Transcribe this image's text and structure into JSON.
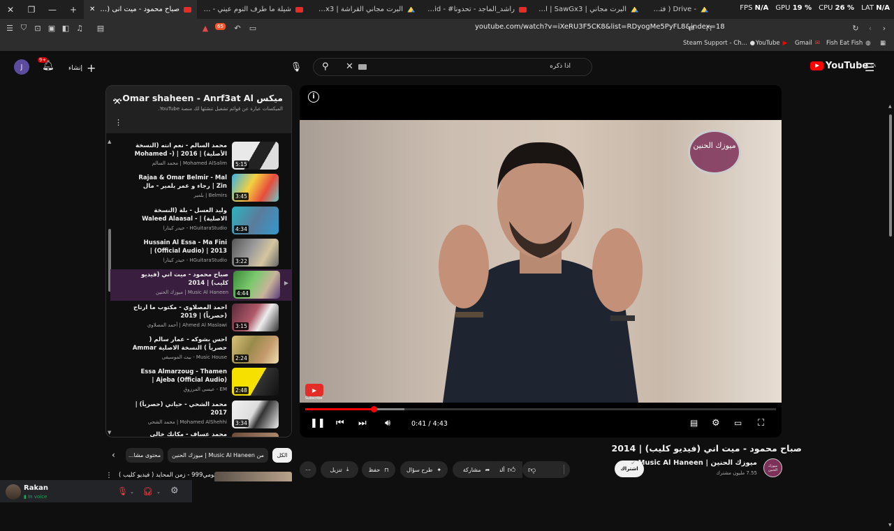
{
  "browser": {
    "tabs": [
      {
        "label": "صباح محمود - ميت انى (3421)",
        "active": true,
        "favicon": "youtube"
      },
      {
        "label": "شيلة ما طرف النوم عيني - YouTube",
        "active": false,
        "favicon": "youtube"
      },
      {
        "label": "البرت مجاني القراشة | Drive - SawGx3",
        "active": false,
        "favicon": "drive"
      },
      {
        "label": "راشد_الماجد - تحدونا# - YouTube - id",
        "active": false,
        "favicon": "youtube"
      },
      {
        "label": "البرت مجاني | SawGx3 | القطوة - Drive",
        "active": false,
        "favicon": "drive"
      },
      {
        "label": "- Drive ( فتحت 5 دولار ) ...",
        "active": false,
        "favicon": "drive"
      }
    ],
    "perf": {
      "fps_label": "FPS",
      "fps": "N/A",
      "gpu_label": "GPU",
      "gpu": "19 %",
      "cpu_label": "CPU",
      "cpu": "26 %",
      "lat_label": "LAT",
      "lat": "N/A"
    },
    "url": "youtube.com/watch?v=iXeRU3F5CK8&list=RDyogMe5PyFL8&index=18",
    "extension_badge": "65",
    "bookmarks": [
      "Steam Support - Ch...",
      "YouTube",
      "Gmail",
      "Fish Eat Fish"
    ]
  },
  "masthead": {
    "logo_text": "YouTube",
    "logo_region": "SA",
    "search_query": "اذا ذكره",
    "create_label": "إنشاء",
    "notif_count": "9+",
    "avatar_letter": "J"
  },
  "playlist": {
    "title": "ميكس Omar shaheen - Anrf3at Al...",
    "subtitle": "الميكسات عبارة عن قوائم تشغيل تنشئها لك منصة YouTube.",
    "items": [
      {
        "title": "محمد السالم - نعم انته (النسخة الأصلية) | 2016 | (- Mohamed Alsalim...",
        "channel": "Mohamed AlSalim | محمد السالم",
        "duration": "5:15",
        "current": false
      },
      {
        "title": "Rajaa & Omar Belmir - Mal Zin | رجاء و عمر بلمير - مال الزين",
        "channel": "Belmirs | بلمير",
        "duration": "3:45",
        "current": false
      },
      {
        "title": "وليد العسل - بلة (النسخة الاصلية) | Waleed Alaasal - Bala (Official)...",
        "channel": "HGuitaraStudio - حيدر كيتارا",
        "duration": "4:34",
        "current": false
      },
      {
        "title": "Hussain Al Essa - Ma Fini (Official Audio) | 2013 | حسين...",
        "channel": "HGuitaraStudio - حيدر كيتارا",
        "duration": "3:22",
        "current": false
      },
      {
        "title": "صباح محمود - ميت اني (فيديو كليب) | 2014",
        "channel": "Music Al Haneen | ميوزك الحنين",
        "duration": "4:44",
        "current": true
      },
      {
        "title": "احمد المصلاوي - مكتوب ما ارتاح (حصرياً) | 2019",
        "channel": "Ahmed Al Maslawi | أحمد المصلاوي",
        "duration": "3:15",
        "current": false
      },
      {
        "title": "احس بشوكه - عمار سالم ( حصرياً ) النسخة الاصلية Ammar Salim",
        "channel": "Music House - بيت الموسيقى",
        "duration": "2:24",
        "current": false
      },
      {
        "title": "Essa Almarzoug - Thamen Ajeba (Official Audio) | عيسى...",
        "channel": "EM - عيسى المرزوق",
        "duration": "2:48",
        "current": false
      },
      {
        "title": "محمد الشحي - حياتي (حصرياً) | 2017",
        "channel": "Mohamed AlShehhi | محمد الشحي",
        "duration": "3:34",
        "current": false
      },
      {
        "title": "محمد عساف - مكانك خالي",
        "channel": "",
        "duration": "",
        "current": false
      }
    ]
  },
  "player": {
    "watermark": "ميوزك الحنين",
    "subscribe_watermark": "Subscribe",
    "current_time": "0:41",
    "total_time": "4:43",
    "progress_fraction": 0.145,
    "buffered_fraction": 0.21
  },
  "video": {
    "title": "صباح محمود - ميت اني (فيديو كليب) | 2014",
    "channel_name": "ميوزك الحنين | Music Al Haneen",
    "subscribers": "7.55 مليون مشترك",
    "subscribe_label": "اشتراك",
    "likes": "136 ألف",
    "share_label": "مشاركة",
    "ask_label": "طرح سؤال",
    "save_label": "حفظ",
    "download_label": "تنزيل"
  },
  "chips": {
    "items": [
      "الكل",
      "من Music Al Haneen | ميوزك الحنين",
      "محتوى مشا..."
    ]
  },
  "related_preview": {
    "title": "نجومي999 - زمن المحايد ( فيديو كليب )"
  },
  "discord": {
    "username": "Rakan",
    "status": "In voice"
  }
}
